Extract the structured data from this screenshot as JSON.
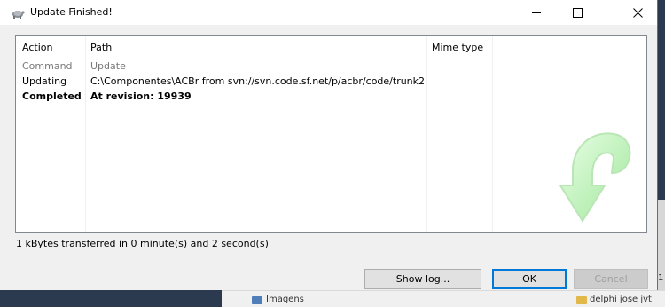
{
  "window": {
    "title": "Update Finished!",
    "icon": "tortoise-icon"
  },
  "list": {
    "columns": [
      "Action",
      "Path",
      "Mime type"
    ],
    "rows": [
      {
        "action": "Command",
        "path": "Update",
        "style": "gray"
      },
      {
        "action": "Updating",
        "path": "C:\\Componentes\\ACBr from svn://svn.code.sf.net/p/acbr/code/trunk2",
        "style": "normal"
      },
      {
        "action": "Completed",
        "path": "At revision: 19939",
        "style": "bold"
      }
    ]
  },
  "status": "1 kBytes transferred in 0 minute(s) and 2 second(s)",
  "buttons": {
    "show_log": "Show log...",
    "ok": "OK",
    "cancel": "Cancel"
  },
  "background": {
    "text_left": "Imagens",
    "text_right": "delphi jose jvt",
    "edge_char": "1"
  },
  "colors": {
    "accent": "#0078d7",
    "arrow_green": "#a8f0a0"
  }
}
